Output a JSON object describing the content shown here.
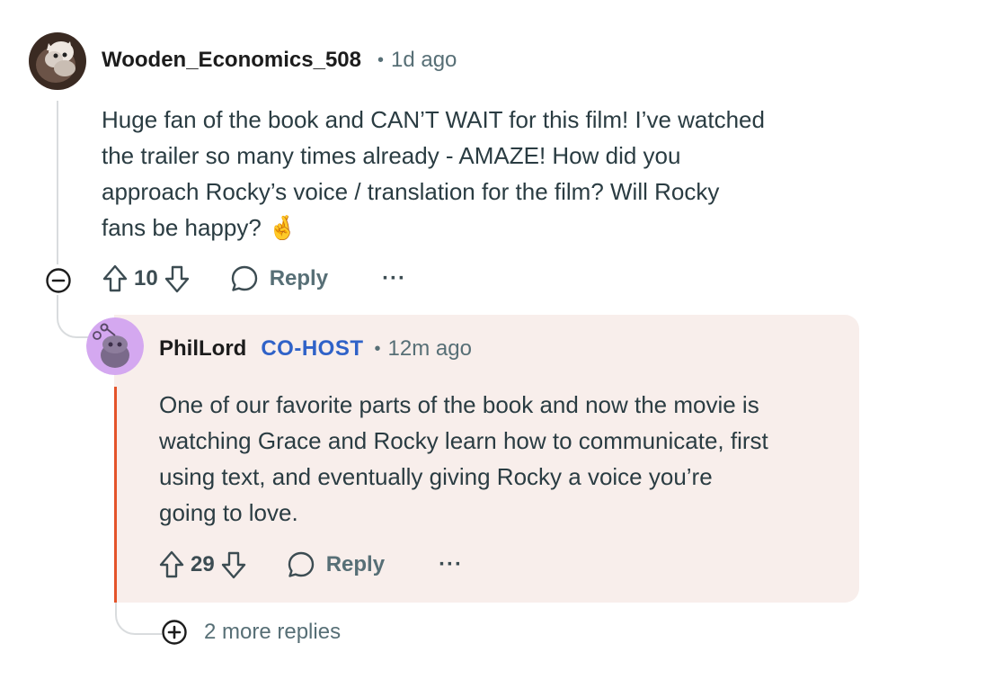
{
  "comment": {
    "username": "Wooden_Economics_508",
    "separator": "•",
    "time": "1d ago",
    "avatar_icon": "cat-photo-avatar",
    "body_lines": [
      "Huge fan of the book and CAN’T WAIT for this film! I’ve watched",
      "the trailer so many times already - AMAZE! How did you",
      "approach Rocky’s voice / translation for the film? Will Rocky",
      "fans be happy? 🤞"
    ],
    "votes": "10",
    "reply_label": "Reply",
    "more_label": "···",
    "collapse_icon": "minus-circle-icon"
  },
  "reply": {
    "username": "PhilLord",
    "flair": "CO-HOST",
    "separator": "•",
    "time": "12m ago",
    "avatar_icon": "snoo-avatar",
    "avatar_color": "#d4a8f0",
    "body_lines": [
      "One of  our favorite parts of the book and now the movie is",
      "watching Grace and Rocky learn how to communicate, first",
      "using text, and eventually giving Rocky a voice you’re",
      "going to love."
    ],
    "votes": "29",
    "reply_label": "Reply",
    "more_label": "···",
    "card_color": "#f8eeeb",
    "accent_color": "#e4532a"
  },
  "more_replies": {
    "label": "2 more replies",
    "icon": "plus-circle-icon"
  }
}
